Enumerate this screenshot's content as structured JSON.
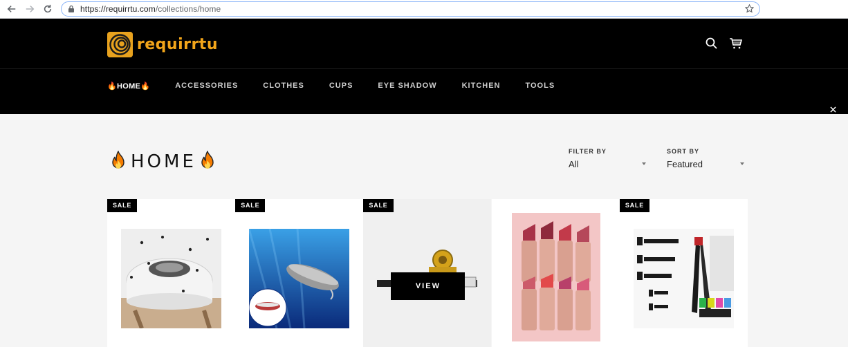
{
  "browser": {
    "url_host": "https://requirrtu.com",
    "url_path": "/collections/home"
  },
  "store": {
    "logo_text": "requirrtu",
    "brand_color": "#f2a51a",
    "nav": [
      {
        "label": "🔥HOME🔥",
        "active": true
      },
      {
        "label": "ACCESSORIES"
      },
      {
        "label": "CLOTHES"
      },
      {
        "label": "CUPS"
      },
      {
        "label": "EYE SHADOW"
      },
      {
        "label": "KITCHEN"
      },
      {
        "label": "TOOLS"
      }
    ]
  },
  "collection": {
    "title": "HOME",
    "filter_label": "FILTER BY",
    "filter_value": "All",
    "sort_label": "SORT BY",
    "sort_value": "Featured"
  },
  "products": [
    {
      "badge": "SALE",
      "image": "fly-trap-device"
    },
    {
      "badge": "SALE",
      "image": "fishing-lure"
    },
    {
      "badge": "SALE",
      "image": "fishing-reel",
      "view_label": "VIEW"
    },
    {
      "badge": "",
      "image": "lipstick-set"
    },
    {
      "badge": "SALE",
      "image": "rivet-tool-kit"
    }
  ]
}
